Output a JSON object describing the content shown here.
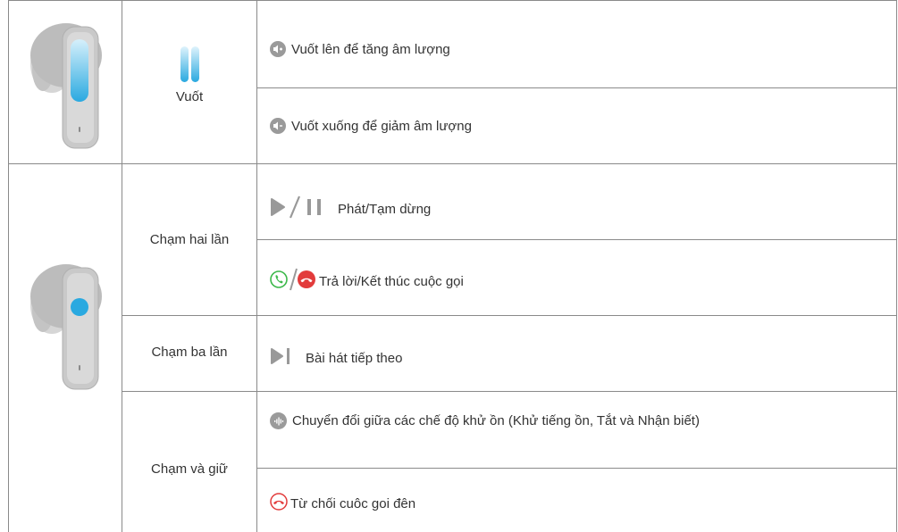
{
  "table": {
    "rows": [
      {
        "gesture": "Vuốt",
        "actions": [
          {
            "icon": "volume-up-icon",
            "text": "Vuốt lên để tăng âm lượng"
          },
          {
            "icon": "volume-down-icon",
            "text": "Vuốt xuống để giảm âm lượng"
          }
        ]
      },
      {
        "gesture": "Chạm hai lần",
        "actions": [
          {
            "icon": "play-pause-icon",
            "text": "Phát/Tạm dừng"
          },
          {
            "icon": "answer-end-call-icon",
            "text": "Trả lời/Kết thúc cuộc gọi"
          }
        ]
      },
      {
        "gesture": "Chạm ba lần",
        "actions": [
          {
            "icon": "next-track-icon",
            "text": "Bài hát tiếp theo"
          }
        ]
      },
      {
        "gesture": "Chạm và giữ",
        "actions": [
          {
            "icon": "noise-control-icon",
            "text": "Chuyển đổi giữa các chế độ khử ồn (Khử tiếng ồn, Tắt và Nhận biết)"
          },
          {
            "icon": "decline-call-icon",
            "text": "Từ chối cuôc goi đên"
          }
        ]
      }
    ]
  },
  "colors": {
    "grid": "#8a8a8a",
    "earbud_body": "#c9c9c9",
    "touch_blue": "#2aa9e0",
    "icon_grey": "#9a9a9a",
    "call_green": "#3cb84a",
    "call_red": "#e23b3b"
  }
}
